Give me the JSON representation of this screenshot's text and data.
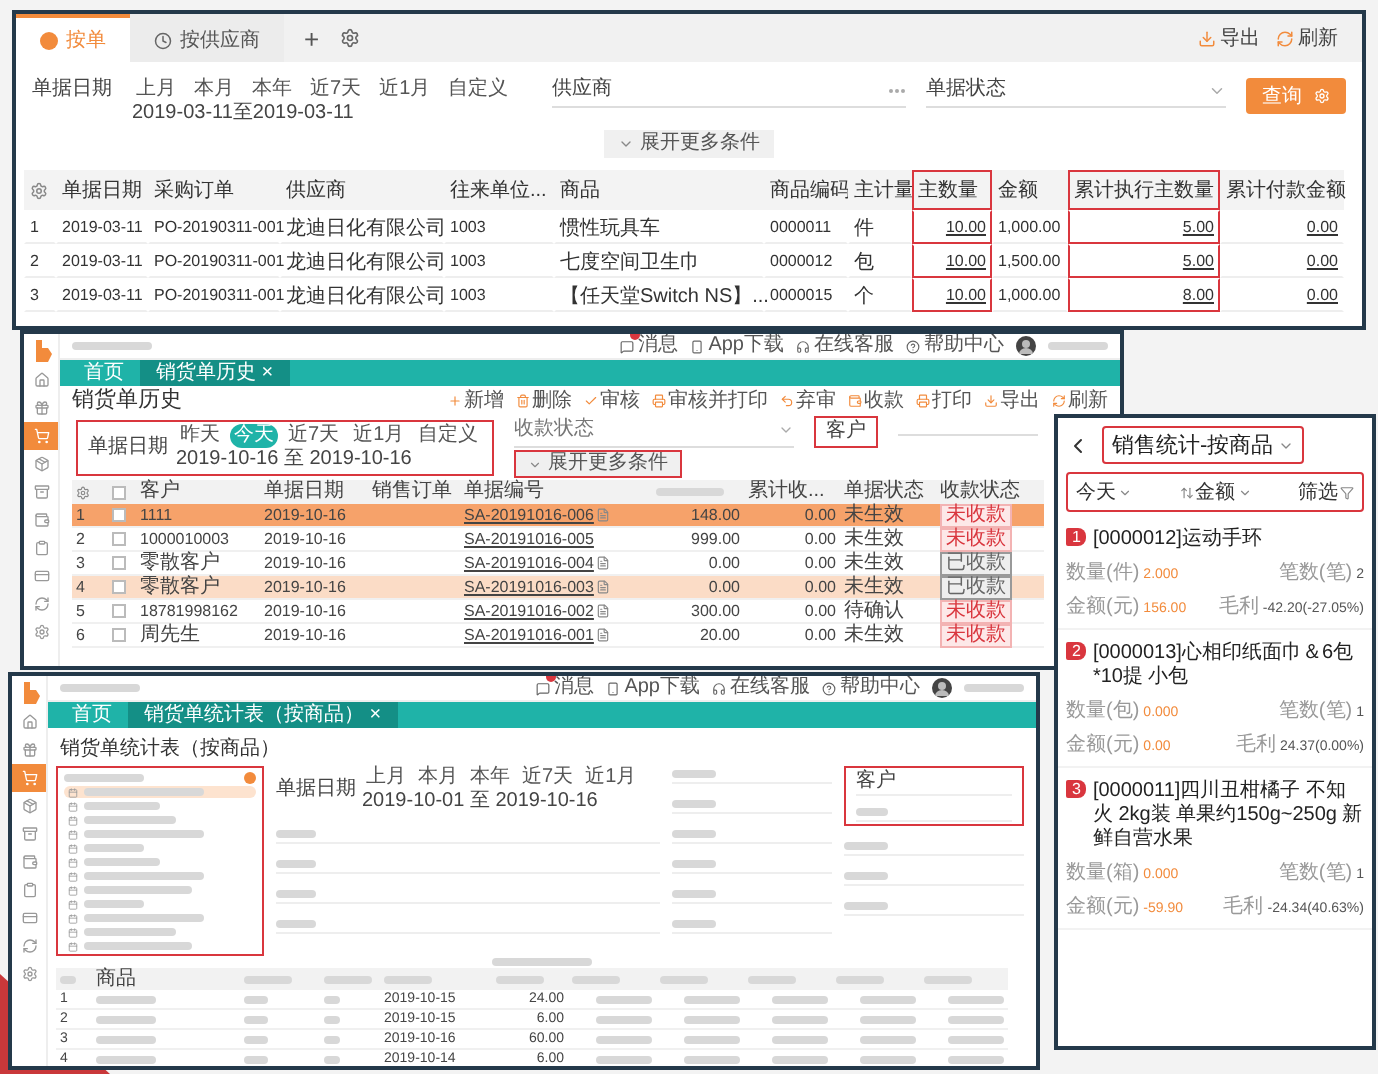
{
  "top_window": {
    "tabs": [
      {
        "label": "按单",
        "selected": true
      },
      {
        "label": "按供应商",
        "selected": false
      }
    ],
    "add_tab": "+",
    "actions": [
      {
        "label": "导出",
        "kind": "export"
      },
      {
        "label": "刷新",
        "kind": "refresh"
      }
    ],
    "date_filter": {
      "label": "单据日期",
      "options": [
        "上月",
        "本月",
        "本年",
        "近7天",
        "近1月",
        "自定义"
      ],
      "range": "2019-03-11至2019-03-11"
    },
    "supplier_field": {
      "label": "供应商"
    },
    "status_field": {
      "label": "单据状态"
    },
    "search_button": "查询",
    "expand_button": "展开更多条件",
    "columns": [
      {
        "kind": "settings",
        "highlighted": false
      },
      {
        "label": "单据日期",
        "kind": "text",
        "highlighted": false
      },
      {
        "label": "采购订单",
        "kind": "text",
        "highlighted": false
      },
      {
        "label": "供应商",
        "kind": "text",
        "highlighted": false
      },
      {
        "label": "往来单位...",
        "kind": "text",
        "highlighted": false
      },
      {
        "label": "商品",
        "kind": "text",
        "highlighted": false
      },
      {
        "label": "商品编码",
        "kind": "text",
        "highlighted": false
      },
      {
        "label": "主计量",
        "kind": "text",
        "highlighted": false
      },
      {
        "label": "主数量",
        "kind": "link",
        "highlighted": true
      },
      {
        "label": "金额",
        "kind": "text",
        "highlighted": false
      },
      {
        "label": "累计执行主数量",
        "kind": "link",
        "highlighted": true
      },
      {
        "label": "累计付款金额",
        "kind": "link",
        "highlighted": false
      }
    ],
    "rows": [
      [
        "1",
        "2019-03-11",
        "PO-20190311-001",
        "龙迪日化有限公司",
        "1003",
        "惯性玩具车",
        "0000011",
        "件",
        "10.00",
        "1,000.00",
        "5.00",
        "0.00"
      ],
      [
        "2",
        "2019-03-11",
        "PO-20190311-001",
        "龙迪日化有限公司",
        "1003",
        "七度空间卫生巾",
        "0000012",
        "包",
        "10.00",
        "1,500.00",
        "5.00",
        "0.00"
      ],
      [
        "3",
        "2019-03-11",
        "PO-20190311-001",
        "龙迪日化有限公司",
        "1003",
        "【任天堂Switch NS】...",
        "0000015",
        "个",
        "10.00",
        "1,000.00",
        "8.00",
        "0.00"
      ]
    ]
  },
  "middle_window": {
    "sidebar": [
      {
        "selected": false
      },
      {
        "selected": false
      },
      {
        "selected": true
      },
      {
        "selected": false
      },
      {
        "selected": false
      },
      {
        "selected": false
      },
      {
        "selected": false
      },
      {
        "selected": false
      },
      {
        "selected": false
      },
      {
        "selected": false
      }
    ],
    "links": [
      {
        "label": "消息",
        "badge": true
      },
      {
        "label": "App下载",
        "badge": false
      },
      {
        "label": "在线客服",
        "badge": false
      },
      {
        "label": "帮助中心",
        "badge": false
      }
    ],
    "tabs": [
      {
        "label": "首页",
        "selected": false
      },
      {
        "label": "销货单历史 ×",
        "selected": true
      }
    ],
    "title": "销货单历史",
    "toolbar": [
      "新增",
      "删除",
      "审核",
      "审核并打印",
      "弃审",
      "收款",
      "打印",
      "导出",
      "刷新"
    ],
    "date_filter": {
      "label": "单据日期",
      "highlighted": true,
      "options": [
        {
          "label": "昨天",
          "selected": false
        },
        {
          "label": "今天",
          "selected": true
        },
        {
          "label": "近7天",
          "selected": false
        },
        {
          "label": "近1月",
          "selected": false
        },
        {
          "label": "自定义",
          "selected": false
        }
      ],
      "range": "2019-10-16 至 2019-10-16"
    },
    "status_field": {
      "label": "收款状态"
    },
    "customer_field": {
      "label": "客户",
      "highlighted": true
    },
    "expand_button": {
      "label": "展开更多条件",
      "highlighted": true
    },
    "select_all_checked": false,
    "columns": [
      {
        "label": "客户",
        "kind": "text"
      },
      {
        "label": "单据日期",
        "kind": "text"
      },
      {
        "label": "销售订单",
        "kind": "text"
      },
      {
        "label": "单据编号",
        "kind": "text"
      },
      {
        "kind": "blurred"
      },
      {
        "label": "累计收...",
        "kind": "text"
      },
      {
        "label": "单据状态",
        "kind": "text"
      },
      {
        "label": "收款状态",
        "kind": "text"
      }
    ],
    "rows": [
      {
        "index": "1",
        "checked": false,
        "selected": true,
        "hovered": false,
        "customer": "1111",
        "date": "2019-10-16",
        "number": "SA-20191016-006",
        "attachment": true,
        "amount": "148.00",
        "received": "0.00",
        "status": "未生效",
        "payment": {
          "label": "未收款",
          "kind": "unpaid"
        }
      },
      {
        "index": "2",
        "checked": false,
        "selected": false,
        "hovered": false,
        "customer": "1000010003",
        "date": "2019-10-16",
        "number": "SA-20191016-005",
        "attachment": false,
        "amount": "999.00",
        "received": "0.00",
        "status": "未生效",
        "payment": {
          "label": "未收款",
          "kind": "unpaid"
        }
      },
      {
        "index": "3",
        "checked": false,
        "selected": false,
        "hovered": false,
        "customer": "零散客户",
        "date": "2019-10-16",
        "number": "SA-20191016-004",
        "attachment": true,
        "amount": "0.00",
        "received": "0.00",
        "status": "未生效",
        "payment": {
          "label": "已收款",
          "kind": "paid"
        }
      },
      {
        "index": "4",
        "checked": false,
        "selected": false,
        "hovered": true,
        "customer": "零散客户",
        "date": "2019-10-16",
        "number": "SA-20191016-003",
        "attachment": true,
        "amount": "0.00",
        "received": "0.00",
        "status": "未生效",
        "payment": {
          "label": "已收款",
          "kind": "paid"
        }
      },
      {
        "index": "5",
        "checked": false,
        "selected": false,
        "hovered": false,
        "customer": "18781998162",
        "date": "2019-10-16",
        "number": "SA-20191016-002",
        "attachment": true,
        "amount": "300.00",
        "received": "0.00",
        "status": "待确认",
        "payment": {
          "label": "未收款",
          "kind": "unpaid"
        }
      },
      {
        "index": "6",
        "checked": false,
        "selected": false,
        "hovered": false,
        "customer": "周先生",
        "date": "2019-10-16",
        "number": "SA-20191016-001",
        "attachment": true,
        "amount": "20.00",
        "received": "0.00",
        "status": "未生效",
        "payment": {
          "label": "未收款",
          "kind": "unpaid"
        }
      }
    ]
  },
  "mobile_window": {
    "title": "销售统计-按商品",
    "filters": [
      {
        "label": "今天",
        "kind": "dropdown"
      },
      {
        "label": "金额",
        "kind": "sort"
      },
      {
        "label": "筛选",
        "kind": "filter"
      }
    ],
    "items": [
      {
        "rank": "1",
        "name": "[0000012]运动手环",
        "stats": [
          {
            "label": "数量(件)",
            "value": "2.000"
          },
          {
            "label": "笔数(笔)",
            "value": "2"
          },
          {
            "label": "金额(元)",
            "value": "156.00"
          },
          {
            "label": "毛利",
            "value": "-42.20(-27.05%)"
          }
        ]
      },
      {
        "rank": "2",
        "name": "[0000013]心相印纸面巾＆6包*10提 小包",
        "stats": [
          {
            "label": "数量(包)",
            "value": "0.000"
          },
          {
            "label": "笔数(笔)",
            "value": "1"
          },
          {
            "label": "金额(元)",
            "value": "0.00"
          },
          {
            "label": "毛利",
            "value": "24.37(0.00%)"
          }
        ]
      },
      {
        "rank": "3",
        "name": "[0000011]四川丑柑橘子 不知火 2kg装 单果约150g~250g 新鲜自营水果",
        "stats": [
          {
            "label": "数量(箱)",
            "value": "0.000"
          },
          {
            "label": "笔数(笔)",
            "value": "1"
          },
          {
            "label": "金额(元)",
            "value": "-59.90"
          },
          {
            "label": "毛利",
            "value": "-24.34(40.63%)"
          }
        ]
      }
    ]
  },
  "bottom_window": {
    "sidebar": [
      {
        "selected": false
      },
      {
        "selected": false
      },
      {
        "selected": true
      },
      {
        "selected": false
      },
      {
        "selected": false
      },
      {
        "selected": false
      },
      {
        "selected": false
      },
      {
        "selected": false
      },
      {
        "selected": false
      },
      {
        "selected": false
      }
    ],
    "links": [
      {
        "label": "消息",
        "badge": true
      },
      {
        "label": "App下载",
        "badge": false
      },
      {
        "label": "在线客服",
        "badge": false
      },
      {
        "label": "帮助中心",
        "badge": false
      }
    ],
    "tabs": [
      {
        "label": "首页",
        "selected": false
      },
      {
        "label": "销货单统计表（按商品） ×",
        "selected": true
      }
    ],
    "title": "销货单统计表（按商品）",
    "report_list": {
      "highlighted": true,
      "items": [
        {
          "selected": true
        },
        {
          "selected": false
        },
        {
          "selected": false
        },
        {
          "selected": false
        },
        {
          "selected": false
        },
        {
          "selected": false
        },
        {
          "selected": false
        },
        {
          "selected": false
        },
        {
          "selected": false
        },
        {
          "selected": false
        },
        {
          "selected": false
        },
        {
          "selected": false
        }
      ]
    },
    "date_filter": {
      "label": "单据日期",
      "options": [
        "上月",
        "本月",
        "本年",
        "近7天",
        "近1月"
      ],
      "range": "2019-10-01 至 2019-10-16"
    },
    "customer_box": {
      "label": "客户",
      "highlighted": true
    },
    "first_column": "商品",
    "rows": [
      {
        "index": "1",
        "date": "2019-10-15",
        "days": "24.00"
      },
      {
        "index": "2",
        "date": "2019-10-15",
        "days": "6.00"
      },
      {
        "index": "3",
        "date": "2019-10-16",
        "days": "60.00"
      },
      {
        "index": "4",
        "date": "2019-10-14",
        "days": "6.00"
      }
    ]
  }
}
